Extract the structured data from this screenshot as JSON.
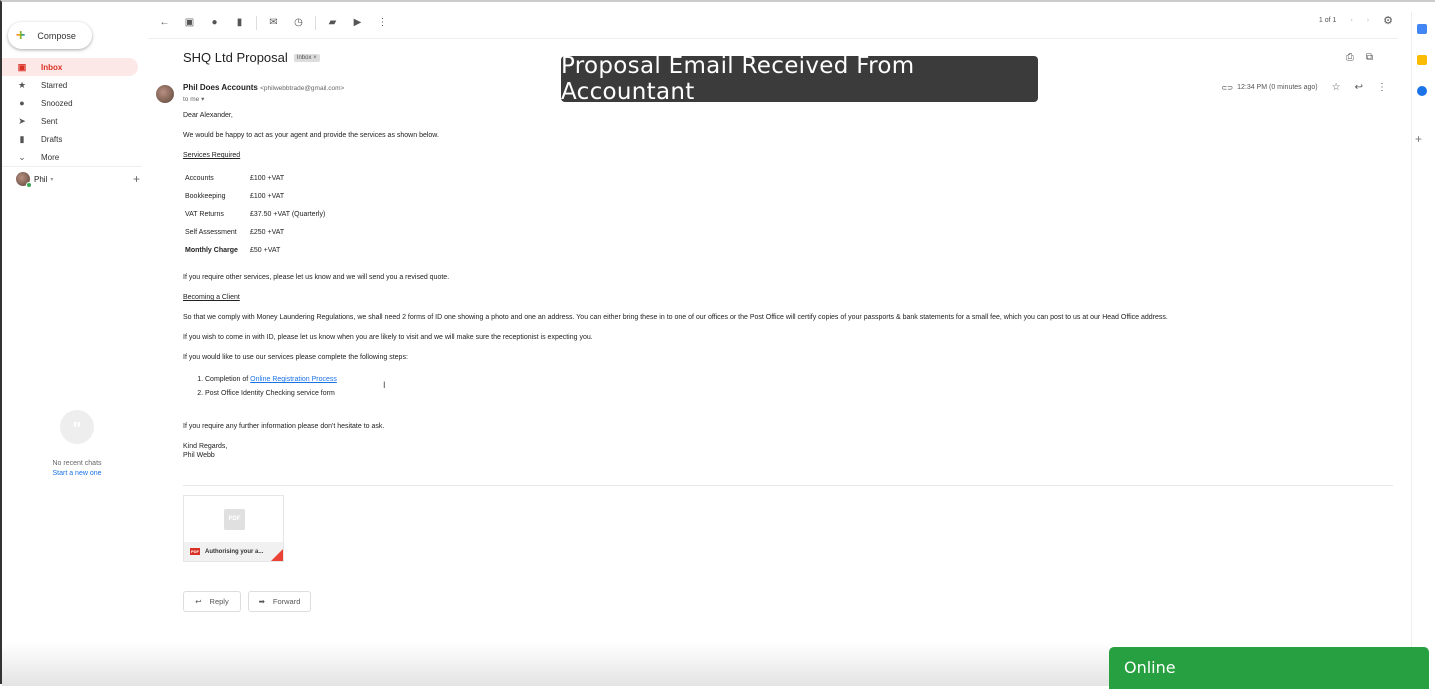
{
  "sidebar": {
    "compose": "Compose",
    "items": [
      {
        "label": "Inbox",
        "icon": "inbox-icon",
        "active": true
      },
      {
        "label": "Starred",
        "icon": "star-icon"
      },
      {
        "label": "Snoozed",
        "icon": "clock-icon"
      },
      {
        "label": "Sent",
        "icon": "send-icon"
      },
      {
        "label": "Drafts",
        "icon": "draft-icon"
      },
      {
        "label": "More",
        "icon": "chevron-down-icon"
      }
    ],
    "user": "Phil",
    "chats": {
      "empty": "No recent chats",
      "start": "Start a new one"
    }
  },
  "toolbar": {
    "pagination": "1 of 1"
  },
  "message": {
    "subject": "SHQ Ltd Proposal",
    "label": "Inbox",
    "sender_name": "Phil Does Accounts",
    "sender_email": "<philwebbtrade@gmail.com>",
    "to": "to me",
    "time": "12:34 PM (0 minutes ago)",
    "greeting": "Dear Alexander,",
    "intro": "We would be happy to act as your agent and provide the services as shown below.",
    "services_heading": "Services Required",
    "services": [
      {
        "name": "Accounts",
        "price": "£100 +VAT"
      },
      {
        "name": "Bookkeeping",
        "price": "£100 +VAT"
      },
      {
        "name": "VAT Returns",
        "price": "£37.50 +VAT (Quarterly)"
      },
      {
        "name": "Self Assessment",
        "price": "£250 +VAT"
      },
      {
        "name": "Monthly Charge",
        "price": "£50 +VAT",
        "bold": true
      }
    ],
    "other": "If you require other services, please let us know and we will send you a revised quote.",
    "client_heading": "Becoming a Client",
    "aml": "So that we comply with Money Laundering Regulations, we shall need 2 forms of ID one showing a photo and one an address. You can either bring these in to one of our offices or the Post Office will certify copies of your passports & bank statements for a small fee, which you can post to us at our Head Office address.",
    "visit": "If you wish to come in with ID, please let us know when you are likely to visit and we will make sure the receptionist is expecting you.",
    "steps_intro": "If you would like to use our services please complete the following steps:",
    "step1_prefix": "Completion of ",
    "step1_link": "Online Registration Process",
    "step2": "Post Office Identity Checking service form",
    "further": "If you require any further information please don't hesitate to ask.",
    "signoff": "Kind Regards,",
    "signature": "Phil Webb",
    "attachment": "Authorising your a...",
    "reply": "Reply",
    "forward": "Forward"
  },
  "overlay_caption": "Proposal Email Received From Accountant",
  "status": "Online",
  "colors": {
    "accent_red": "#d93025",
    "online_green": "#26a040",
    "link": "#1a73e8"
  }
}
